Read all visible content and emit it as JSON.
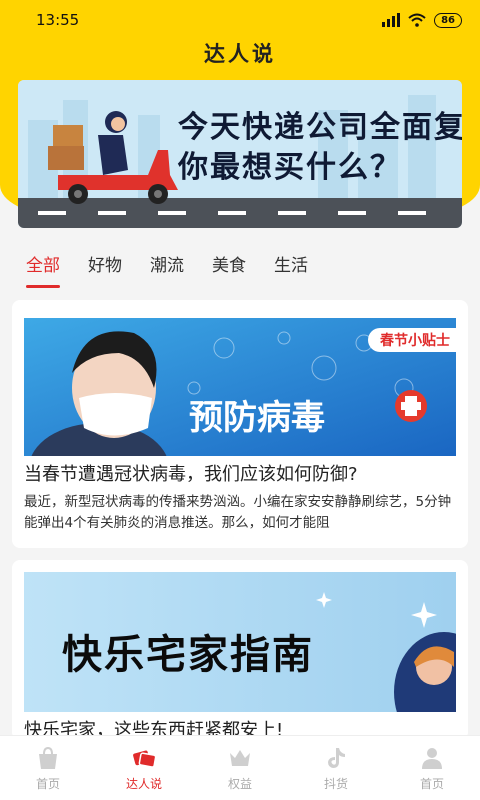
{
  "status": {
    "time": "13:55",
    "battery": "86"
  },
  "header": {
    "title": "达人说"
  },
  "banner": {
    "line1": "今天快递公司全面复工",
    "line2": "你最想买什么？"
  },
  "tabs": [
    {
      "label": "全部",
      "active": true
    },
    {
      "label": "好物"
    },
    {
      "label": "潮流"
    },
    {
      "label": "美食"
    },
    {
      "label": "生活"
    }
  ],
  "articles": [
    {
      "image_tag": "春节小贴士",
      "image_text": "预防病毒",
      "title": "当春节遭遇冠状病毒，我们应该如何防御?",
      "summary": "最近，新型冠状病毒的传播来势汹汹。小编在家安安静静刷综艺，5分钟能弹出4个有关肺炎的消息推送。那么，如何才能阻"
    },
    {
      "image_text": "快乐宅家指南",
      "title": "快乐宅家，这些东西赶紧都安上!"
    }
  ],
  "bottom_nav": [
    {
      "label": "首页",
      "icon": "shopping-bag-icon"
    },
    {
      "label": "达人说",
      "icon": "tickets-icon",
      "active": true
    },
    {
      "label": "权益",
      "icon": "crown-icon"
    },
    {
      "label": "抖货",
      "icon": "tiktok-icon"
    },
    {
      "label": "首页",
      "icon": "user-icon"
    }
  ],
  "colors": {
    "brand_yellow": "#ffd400",
    "accent_red": "#e02b2b"
  }
}
